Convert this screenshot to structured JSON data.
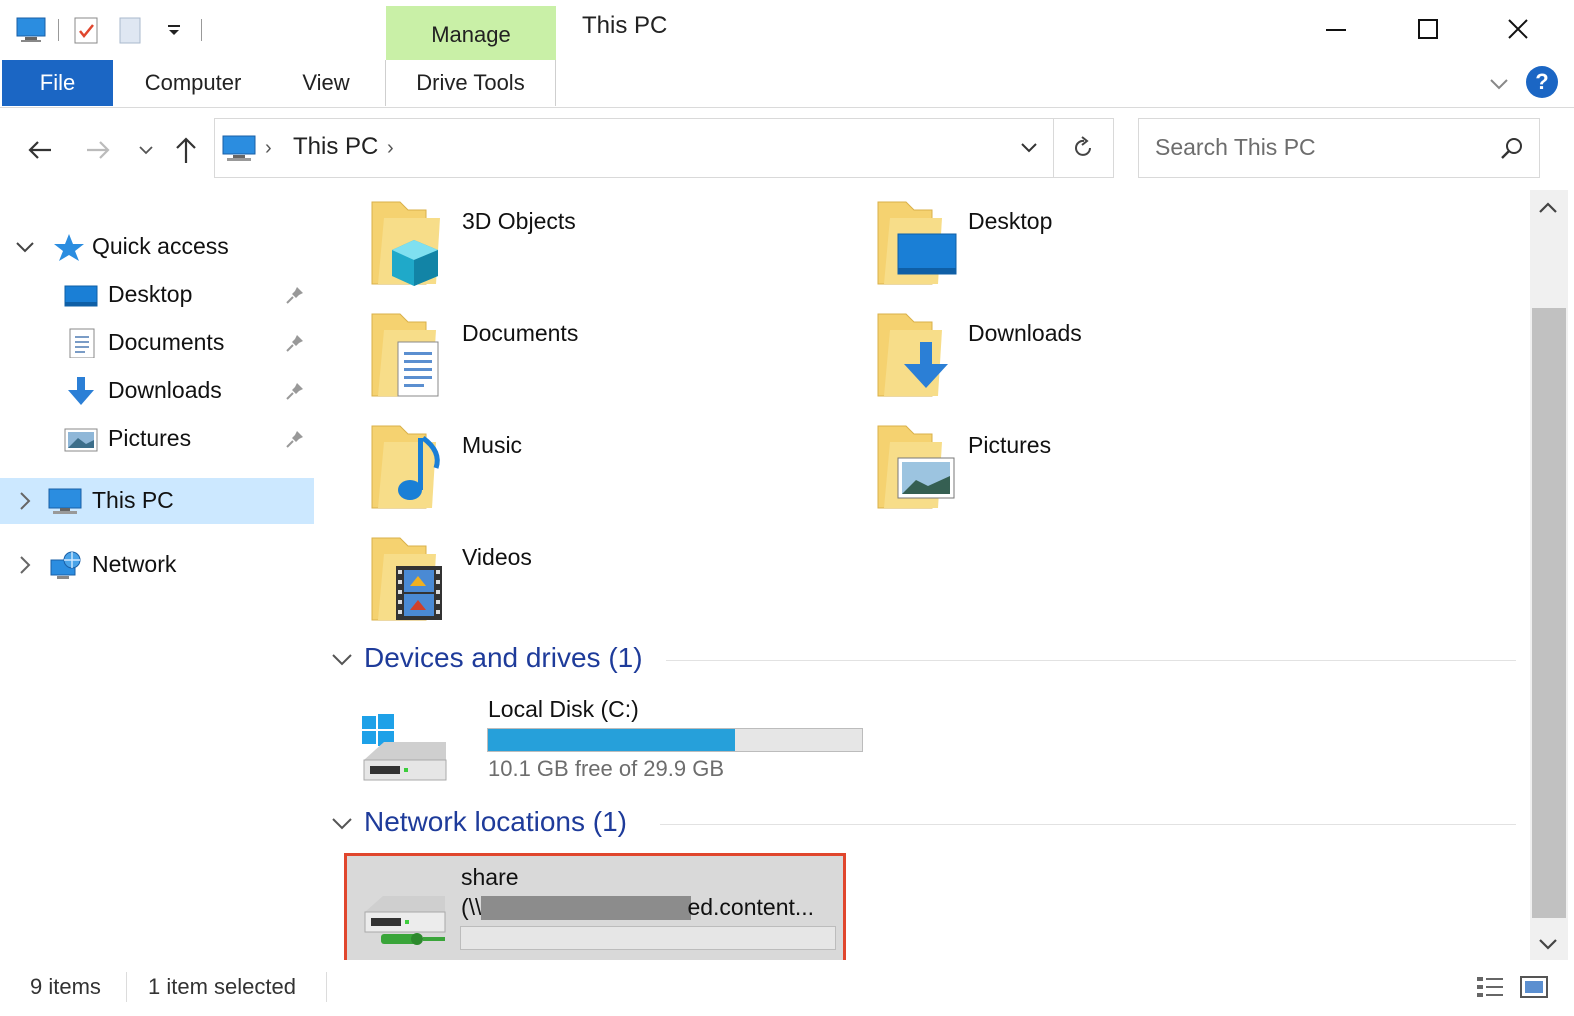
{
  "titlebar": {
    "title": "This PC",
    "context_tab": "Manage",
    "quick_access_toolbar": [
      "pc-icon",
      "properties-icon",
      "new-folder-icon",
      "customize-dropdown-icon"
    ],
    "controls": [
      "minimize-icon",
      "maximize-icon",
      "close-icon"
    ]
  },
  "ribbon": {
    "tabs": [
      {
        "label": "File",
        "active": true
      },
      {
        "label": "Computer"
      },
      {
        "label": "View"
      },
      {
        "label": "Drive Tools"
      }
    ],
    "help_label": "?"
  },
  "address": {
    "path": "This PC",
    "search_placeholder": "Search This PC"
  },
  "navpane": {
    "quick_access": "Quick access",
    "pinned": [
      {
        "label": "Desktop",
        "icon": "desktop-icon"
      },
      {
        "label": "Documents",
        "icon": "documents-icon"
      },
      {
        "label": "Downloads",
        "icon": "downloads-icon"
      },
      {
        "label": "Pictures",
        "icon": "pictures-icon"
      }
    ],
    "this_pc": "This PC",
    "network": "Network"
  },
  "folders": [
    {
      "label": "3D Objects",
      "icon": "3d-objects-folder-icon"
    },
    {
      "label": "Desktop",
      "icon": "desktop-folder-icon"
    },
    {
      "label": "Documents",
      "icon": "documents-folder-icon"
    },
    {
      "label": "Downloads",
      "icon": "downloads-folder-icon"
    },
    {
      "label": "Music",
      "icon": "music-folder-icon"
    },
    {
      "label": "Pictures",
      "icon": "pictures-folder-icon"
    },
    {
      "label": "Videos",
      "icon": "videos-folder-icon"
    }
  ],
  "groups": {
    "devices": "Devices and drives (1)",
    "network_locations": "Network locations (1)"
  },
  "drives": {
    "local": {
      "name": "Local Disk (C:)",
      "free_text": "10.1 GB free of 29.9 GB",
      "used_fraction": 0.66,
      "bar_color": "#26a0da"
    },
    "network": {
      "name": "share",
      "path_prefix": "(\\\\",
      "path_suffix": "ed.content...",
      "selected": true,
      "highlight_color": "#e0462d"
    }
  },
  "status": {
    "count": "9 items",
    "selected": "1 item selected"
  }
}
